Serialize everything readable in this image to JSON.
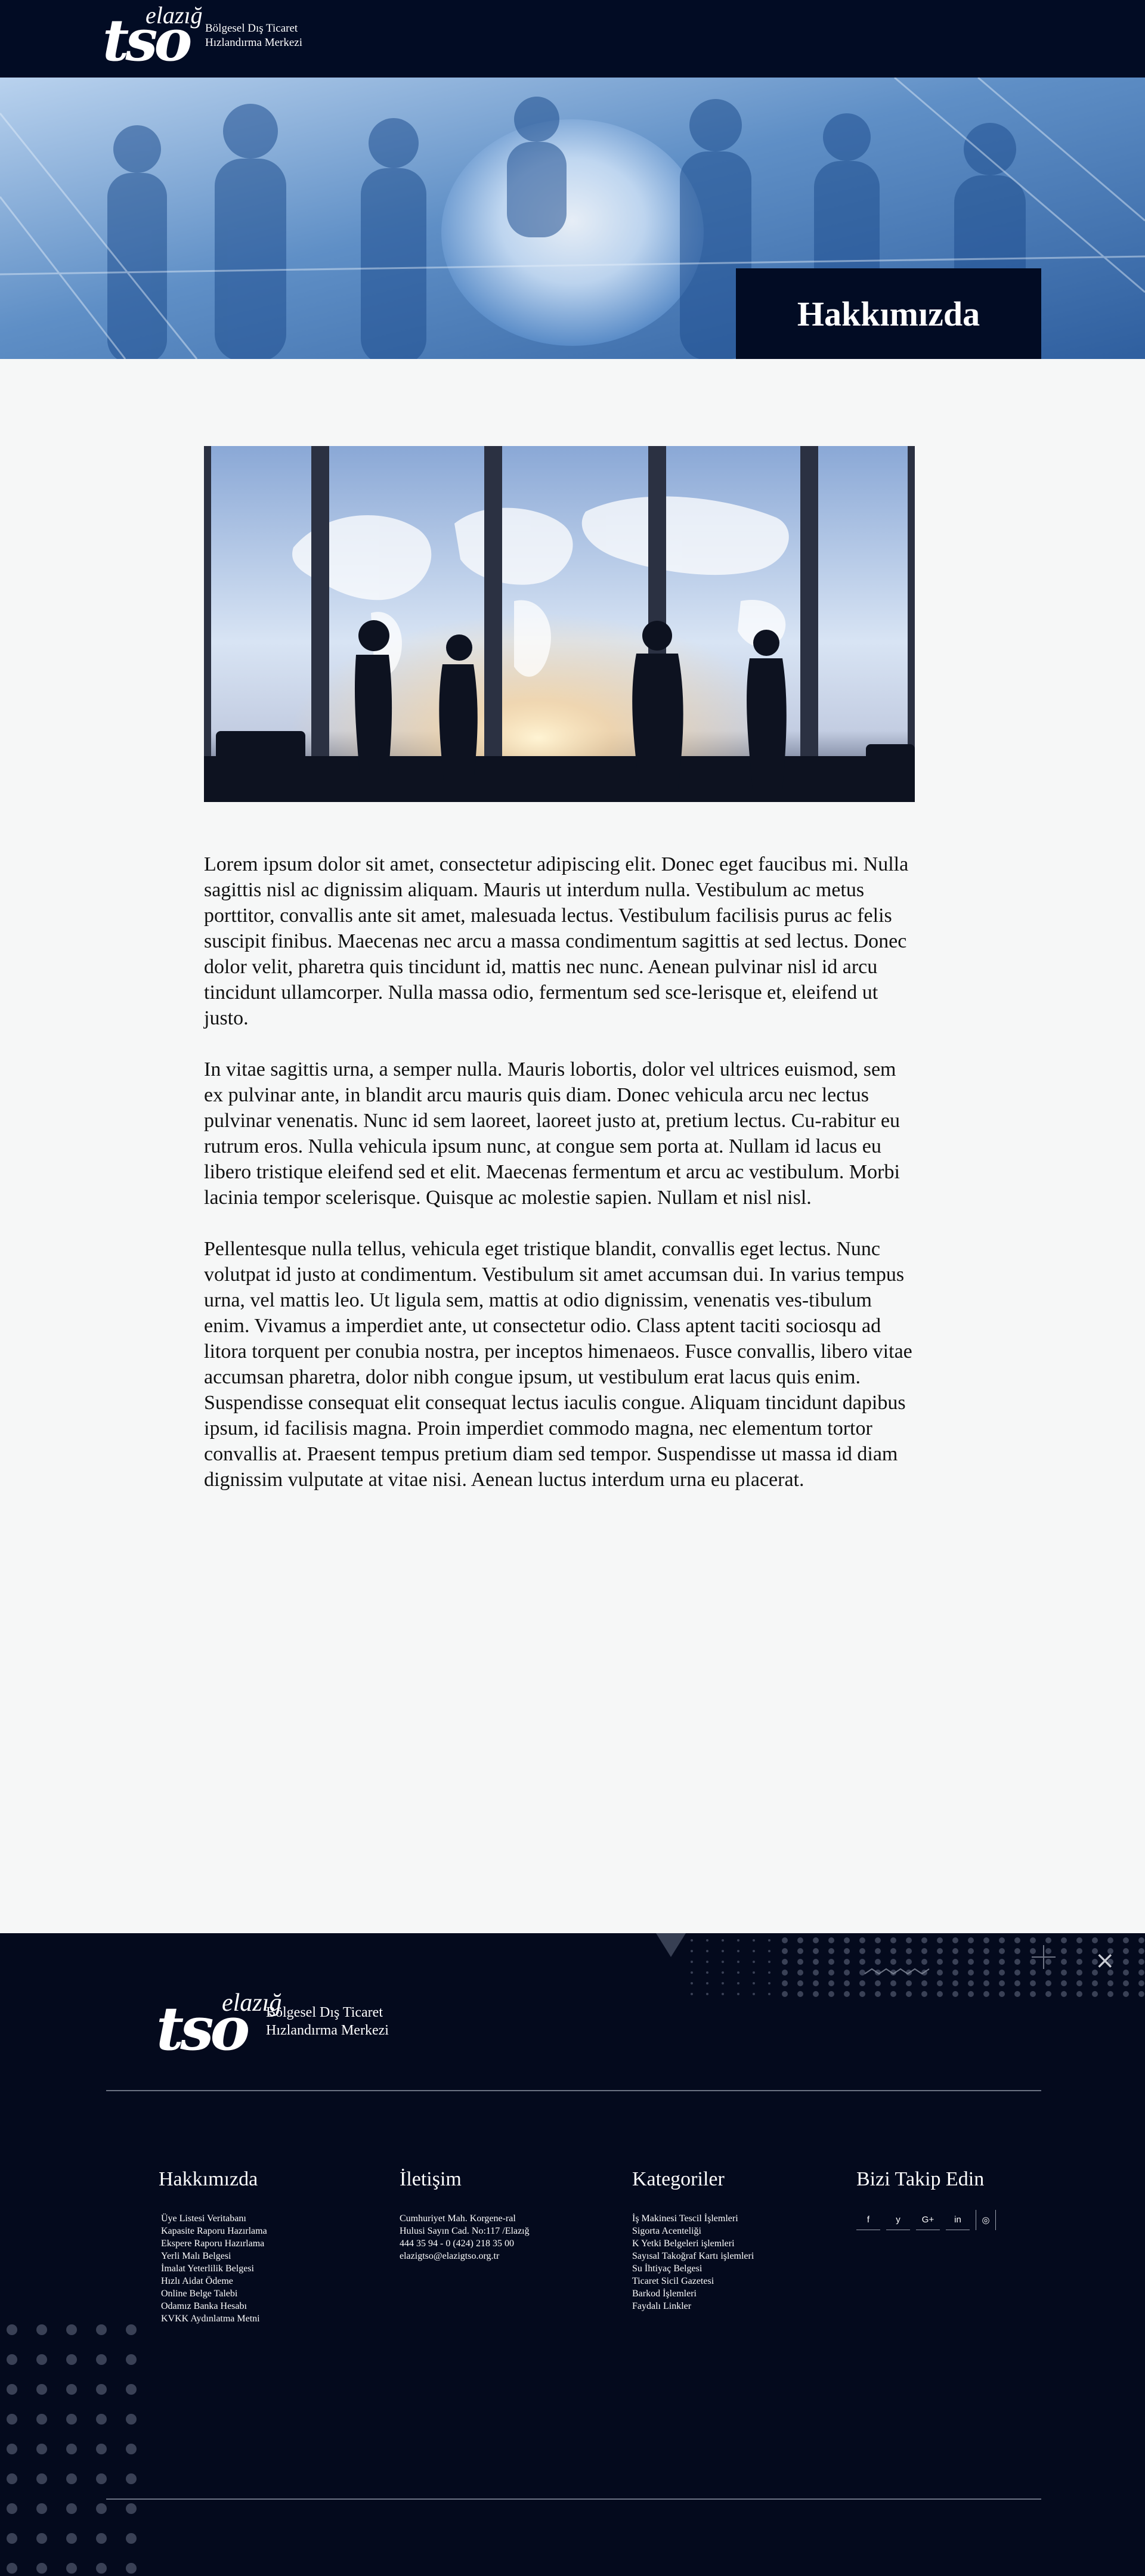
{
  "header": {
    "logo_small": "elazığ",
    "logo_big": "tso",
    "tagline_line1": "Bölgesel Dış Ticaret",
    "tagline_line2": "Hızlandırma Merkezi"
  },
  "hero": {
    "title": "Hakkımızda"
  },
  "article": {
    "paragraphs": [
      "Lorem ipsum dolor sit amet, consectetur adipiscing elit. Donec eget faucibus mi. Nulla sagittis nisl ac dignissim aliquam. Mauris ut interdum nulla. Vestibulum ac metus porttitor, convallis ante sit amet, malesuada lectus. Vestibulum facilisis purus ac felis suscipit finibus. Maecenas nec arcu a massa condimentum sagittis at sed lectus. Donec dolor velit, pharetra quis tincidunt id, mattis nec nunc. Aenean pulvinar nisl id arcu tincidunt ullamcorper. Nulla massa odio, fermentum sed sce-lerisque et, eleifend ut justo.",
      "In vitae sagittis urna, a semper nulla. Mauris lobortis, dolor vel ultrices euismod, sem ex pulvinar ante, in blandit arcu mauris quis diam. Donec vehicula arcu nec lectus pulvinar venenatis. Nunc id sem laoreet, laoreet justo at, pretium lectus. Cu-rabitur eu rutrum eros. Nulla vehicula ipsum nunc, at congue sem porta at. Nullam id lacus eu libero tristique eleifend sed et elit. Maecenas fermentum et arcu ac vestibulum. Morbi lacinia tempor scelerisque. Quisque ac molestie sapien. Nullam et nisl nisl.",
      "Pellentesque nulla tellus, vehicula eget tristique blandit, convallis eget lectus. Nunc volutpat id justo at condimentum. Vestibulum sit amet accumsan dui. In varius tempus urna, vel mattis leo. Ut ligula sem, mattis at odio dignissim, venenatis ves-tibulum enim. Vivamus a imperdiet ante, ut consectetur odio. Class aptent taciti sociosqu ad litora torquent per conubia nostra, per inceptos himenaeos. Fusce convallis, libero vitae accumsan pharetra, dolor nibh congue ipsum, ut vestibulum erat lacus quis enim. Suspendisse consequat elit consequat lectus iaculis congue. Aliquam tincidunt dapibus ipsum, id facilisis magna. Proin imperdiet commodo magna, nec elementum tortor convallis at. Praesent tempus pretium diam sed tempor. Suspendisse ut massa id diam dignissim vulputate at vitae nisi. Aenean luctus interdum urna eu placerat."
    ]
  },
  "footer": {
    "logo_small": "elazığ",
    "logo_big": "tso",
    "tagline_line1": "Bölgesel Dış Ticaret",
    "tagline_line2": "Hızlandırma Merkezi",
    "about": {
      "title": "Hakkımızda",
      "links": [
        "Üye Listesi Veritabanı",
        "Kapasite Raporu Hazırlama",
        "Ekspere Raporu Hazırlama",
        "Yerli Malı Belgesi",
        "İmalat Yeterlilik Belgesi",
        "Hızlı Aidat Ödeme",
        "Online Belge Talebi",
        "Odamız Banka Hesabı",
        "KVKK Aydınlatma Metni"
      ]
    },
    "contact": {
      "title": "İletişim",
      "address": "Cumhuriyet Mah. Korgene-ral Hulusi Sayın Cad. No:117 /Elazığ",
      "phones": "444 35 94 - 0 (424) 218 35 00",
      "email": "elazigtso@elazigtso.org.tr"
    },
    "categories": {
      "title": "Kategoriler",
      "links": [
        "İş Makinesi Tescil İşlemleri",
        "Sigorta Acenteliği",
        "K Yetki Belgeleri işlemleri",
        "Sayısal Takoğraf Kartı işlemleri",
        "Su İhtiyaç Belgesi",
        "Ticaret Sicil Gazetesi",
        "Barkod İşlemleri",
        "Faydalı Linkler"
      ]
    },
    "follow": {
      "title": "Bizi Takip Edin",
      "icons": [
        "f",
        "y",
        "G+",
        "in",
        "◎"
      ]
    },
    "close_glyph": "×"
  }
}
